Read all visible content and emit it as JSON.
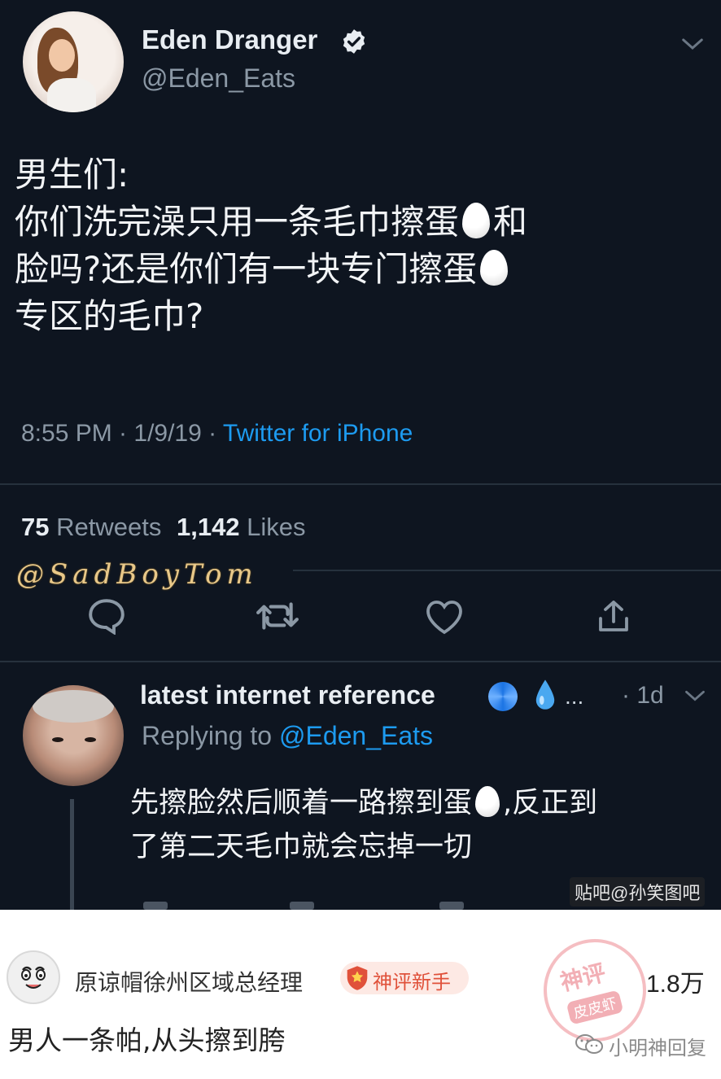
{
  "tweet": {
    "author_name": "Eden Dranger",
    "author_handle": "@Eden_Eats",
    "text_line1": "男生们:",
    "text_line2": "你们洗完澡只用一条毛巾擦蛋",
    "text_line2_tail": "和",
    "text_line3": "脸吗?还是你们有一块专门擦蛋",
    "text_line4": "专区的毛巾?",
    "time_date": "8:55 PM · 1/9/19 · ",
    "source": "Twitter for iPhone",
    "retweets_count": "75",
    "retweets_label": "Retweets",
    "likes_count": "1,142",
    "likes_label": "Likes",
    "watermark": "@SadBoyTom"
  },
  "reply": {
    "author_name": "latest internet reference",
    "more": "...",
    "time": "· 1d",
    "replying_prefix": "Replying to ",
    "replying_handle": "@Eden_Eats",
    "text_part1": "先擦脸然后顺着一路擦到蛋",
    "text_part2": ",反正到",
    "text_line2": "了第二天毛巾就会忘掉一切",
    "watermark": "贴吧@孙笑图吧"
  },
  "comment": {
    "username": "原谅帽徐州区域总经理",
    "badge_label": "神评新手",
    "likes": "1.8万",
    "text": "男人一条帕,从头擦到胯",
    "stamp_text_1": "神评",
    "stamp_text_2": "皮皮虾",
    "wechat_label": "小明神回复"
  },
  "colors": {
    "background": "#0e1520",
    "link": "#1d9bf0",
    "muted": "#8b98a5",
    "badge_red": "#e0513a"
  },
  "icons": [
    "verified-icon",
    "chevron-down-icon",
    "reply-icon",
    "retweet-icon",
    "like-icon",
    "share-icon",
    "swirl-emoji-icon",
    "droplet-emoji-icon",
    "egg-emoji-icon",
    "shield-badge-icon",
    "wechat-icon"
  ]
}
